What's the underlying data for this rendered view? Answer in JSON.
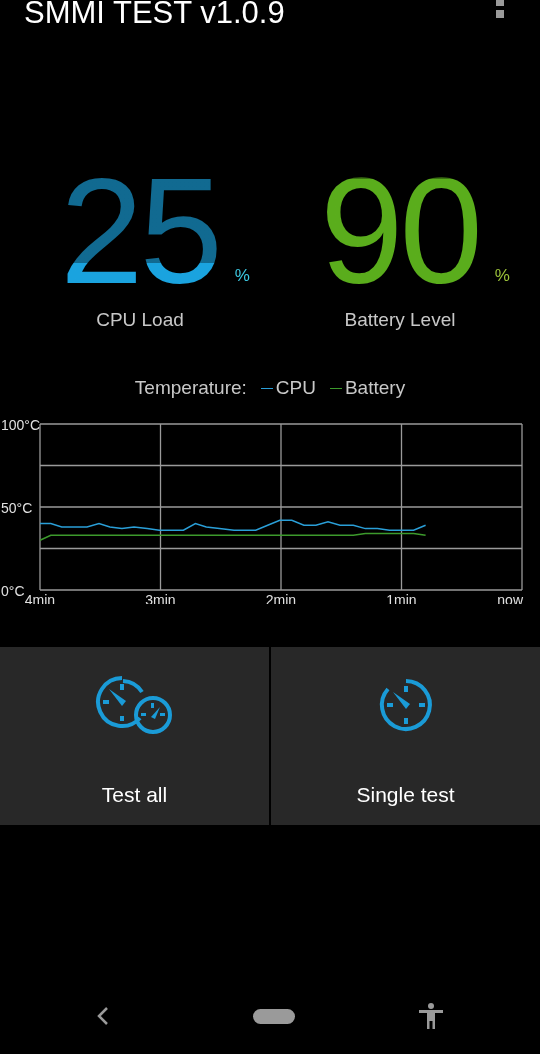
{
  "app_bar": {
    "title": "SMMI TEST v1.0.9"
  },
  "gauges": [
    {
      "kind": "cpu",
      "value": "25",
      "unit": "%",
      "label": "CPU Load"
    },
    {
      "kind": "battery",
      "value": "90",
      "unit": "%",
      "label": "Battery Level"
    }
  ],
  "temperature": {
    "legend_title": "Temperature:",
    "chart_data": {
      "type": "line",
      "x": [
        -4.0,
        -3.91,
        -3.82,
        -3.61,
        -3.51,
        -3.42,
        -3.32,
        -3.22,
        -3.11,
        -3.01,
        -2.81,
        -2.71,
        -2.62,
        -2.51,
        -2.39,
        -2.21,
        -2.11,
        -2.01,
        -1.91,
        -1.81,
        -1.71,
        -1.61,
        -1.51,
        -1.4,
        -1.3,
        -1.2,
        -1.1,
        -0.9,
        -0.8
      ],
      "series": [
        {
          "name": "CPU",
          "color": "#2a9fd8",
          "values": [
            40,
            40,
            38,
            38,
            40,
            38,
            37,
            38,
            37,
            36,
            36,
            40,
            38,
            37,
            36,
            36,
            39,
            42,
            42,
            39,
            39,
            41,
            39,
            39,
            37,
            37,
            36,
            36,
            39
          ]
        },
        {
          "name": "Battery",
          "color": "#3c9a2c",
          "values": [
            30,
            33,
            33,
            33,
            33,
            33,
            33,
            33,
            33,
            33,
            33,
            33,
            33,
            33,
            33,
            33,
            33,
            33,
            33,
            33,
            33,
            33,
            33,
            33,
            34,
            34,
            34,
            34,
            33
          ]
        }
      ],
      "xlim": [
        -4,
        0
      ],
      "ylim": [
        0,
        100
      ],
      "grid": true,
      "xticks": [
        {
          "value": -4,
          "label": "4min"
        },
        {
          "value": -3,
          "label": "3min"
        },
        {
          "value": -2,
          "label": "2min"
        },
        {
          "value": -1,
          "label": "1min"
        },
        {
          "value": 0,
          "label": "now"
        }
      ],
      "yticks": [
        {
          "value": 0,
          "label": "0°C"
        },
        {
          "value": 50,
          "label": "50°C"
        },
        {
          "value": 100,
          "label": "100°C"
        }
      ]
    }
  },
  "actions": [
    {
      "kind": "all",
      "label": "Test all"
    },
    {
      "kind": "single",
      "label": "Single test"
    }
  ]
}
